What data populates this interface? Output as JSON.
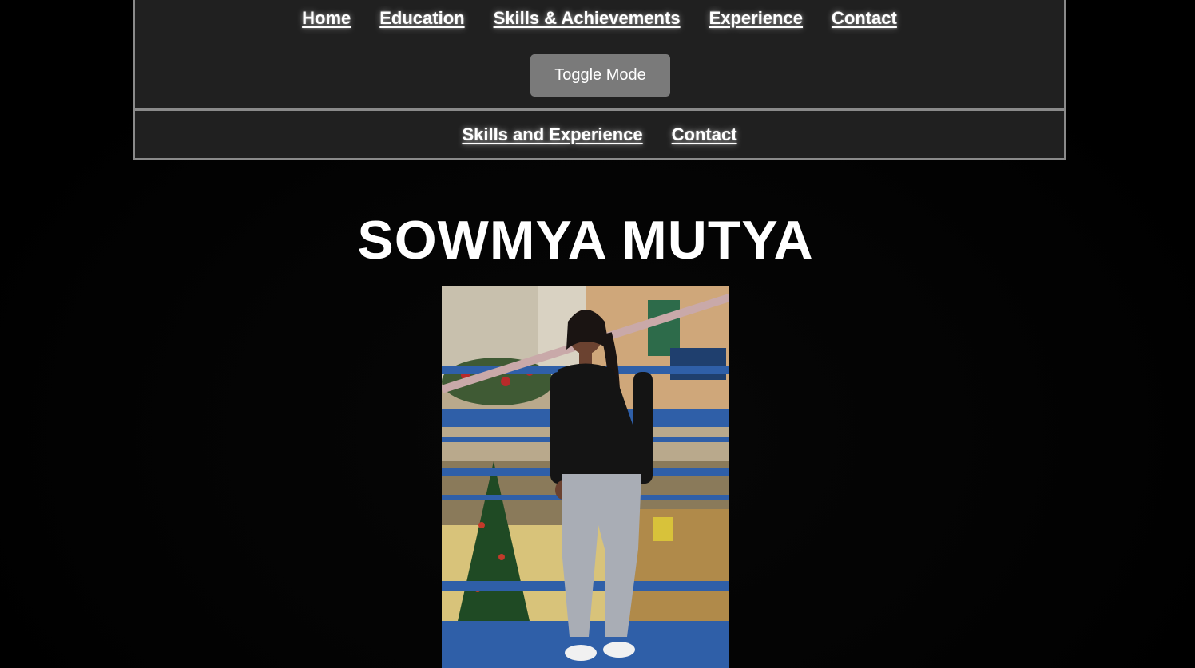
{
  "nav_primary": {
    "links": [
      {
        "label": "Home"
      },
      {
        "label": "Education"
      },
      {
        "label": "Skills & Achievements"
      },
      {
        "label": "Experience"
      },
      {
        "label": "Contact"
      }
    ],
    "toggle_label": "Toggle Mode"
  },
  "nav_secondary": {
    "links": [
      {
        "label": "Skills and Experience"
      },
      {
        "label": "Contact"
      }
    ]
  },
  "hero": {
    "name": "SOWMYA MUTYA"
  },
  "colors": {
    "background": "#000000",
    "navbar_bg": "#202020",
    "navbar_border": "#8a8a8a",
    "button_bg": "#7a7a7a",
    "text": "#ffffff",
    "railing_blue": "#2f5fa8"
  },
  "photo_icon": "profile-photo"
}
